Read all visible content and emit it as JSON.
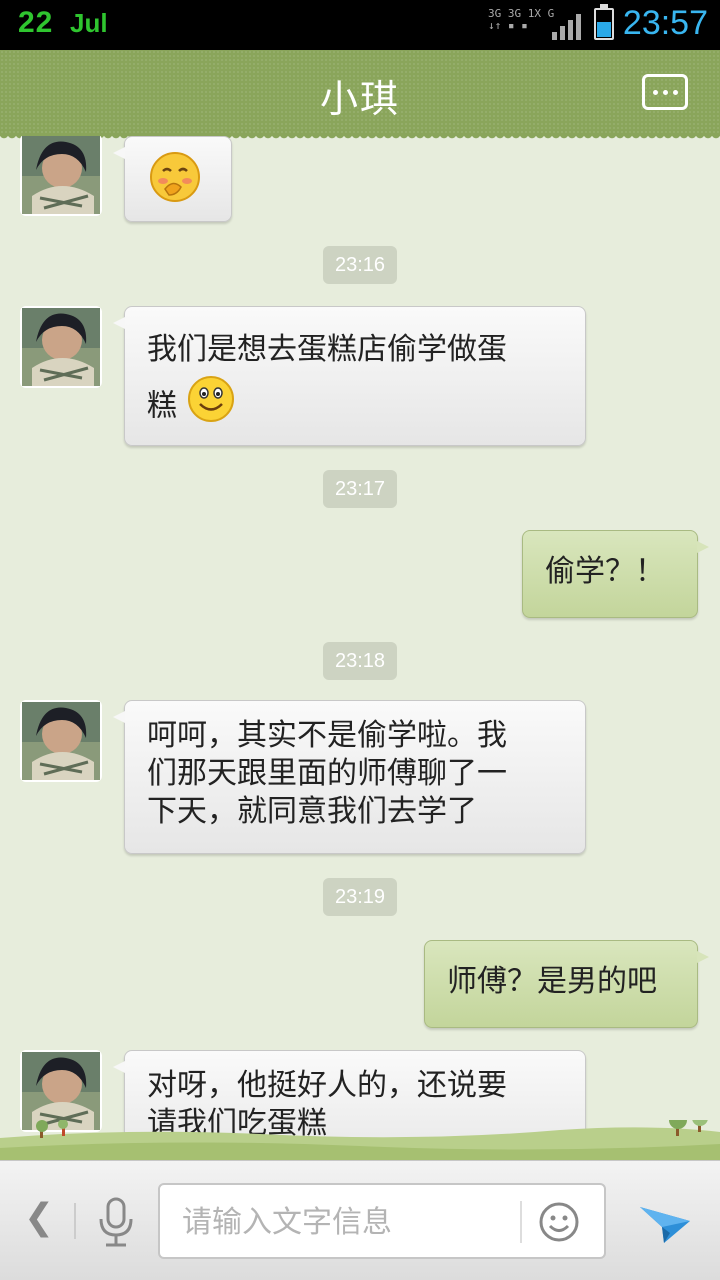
{
  "status_bar": {
    "date": "22",
    "month": "Jul",
    "network": [
      "3G",
      "3G 1X",
      "G"
    ],
    "time": "23:57",
    "battery_level": 0.55
  },
  "header": {
    "title": "小琪",
    "menu_icon": "more-dots-icon"
  },
  "messages": [
    {
      "type": "received",
      "text": "",
      "emoji": "shy-smile"
    },
    {
      "type": "timestamp",
      "text": "23:16"
    },
    {
      "type": "received",
      "text_line1": "我们是想去蛋糕店偷学做蛋",
      "text_line2": "糕",
      "emoji": "smile"
    },
    {
      "type": "timestamp",
      "text": "23:17"
    },
    {
      "type": "sent",
      "text": "偷学？！"
    },
    {
      "type": "timestamp",
      "text": "23:18"
    },
    {
      "type": "received",
      "lines": [
        "呵呵，其实不是偷学啦。我",
        "们那天跟里面的师傅聊了一",
        "下天，就同意我们去学了"
      ]
    },
    {
      "type": "timestamp",
      "text": "23:19"
    },
    {
      "type": "sent",
      "text": "师傅？是男的吧"
    },
    {
      "type": "received",
      "lines": [
        "对呀，他挺好人的，还说要",
        "请我们吃蛋糕"
      ]
    }
  ],
  "input_bar": {
    "placeholder": "请输入文字信息",
    "back_icon": "chevron-left-icon",
    "mic_icon": "microphone-icon",
    "emoji_icon": "smiley-icon",
    "send_icon": "paper-plane-icon"
  },
  "colors": {
    "header_green": "#8aa55b",
    "background": "#e7eddc",
    "sent_bubble": "#c9d9a4",
    "received_bubble": "#efefef",
    "time_accent": "#39b6f0"
  }
}
